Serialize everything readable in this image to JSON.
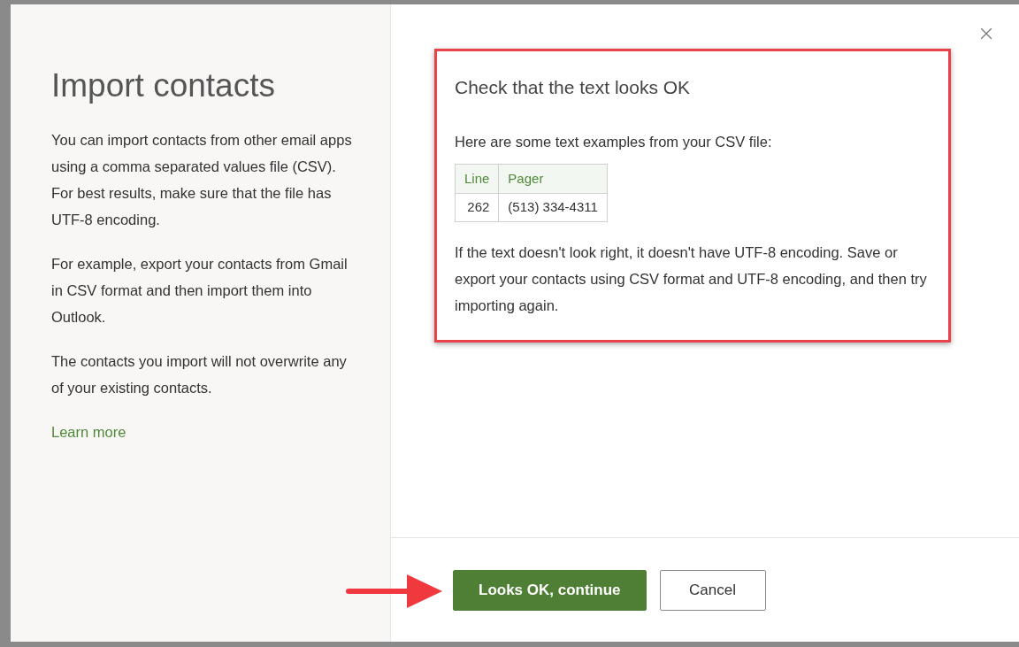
{
  "sidebar": {
    "title": "Import contacts",
    "paragraphs": [
      "You can import contacts from other email apps using a comma separated values file (CSV). For best results, make sure that the file has UTF-8 encoding.",
      "For example, export your contacts from Gmail in CSV format and then import them into Outlook.",
      "The contacts you import will not overwrite any of your existing contacts."
    ],
    "link": "Learn more"
  },
  "check": {
    "heading": "Check that the text looks OK",
    "intro": "Here are some text examples from your CSV file:",
    "table": {
      "columns": [
        "Line",
        "Pager"
      ],
      "rows": [
        [
          "262",
          "(513) 334-4311"
        ]
      ]
    },
    "note": "If the text doesn't look right, it doesn't have UTF-8 encoding. Save or export your contacts using CSV format and UTF-8 encoding, and then try importing again."
  },
  "buttons": [
    {
      "label": "Looks OK, continue",
      "kind": "primary"
    },
    {
      "label": "Cancel",
      "kind": "secondary"
    }
  ]
}
